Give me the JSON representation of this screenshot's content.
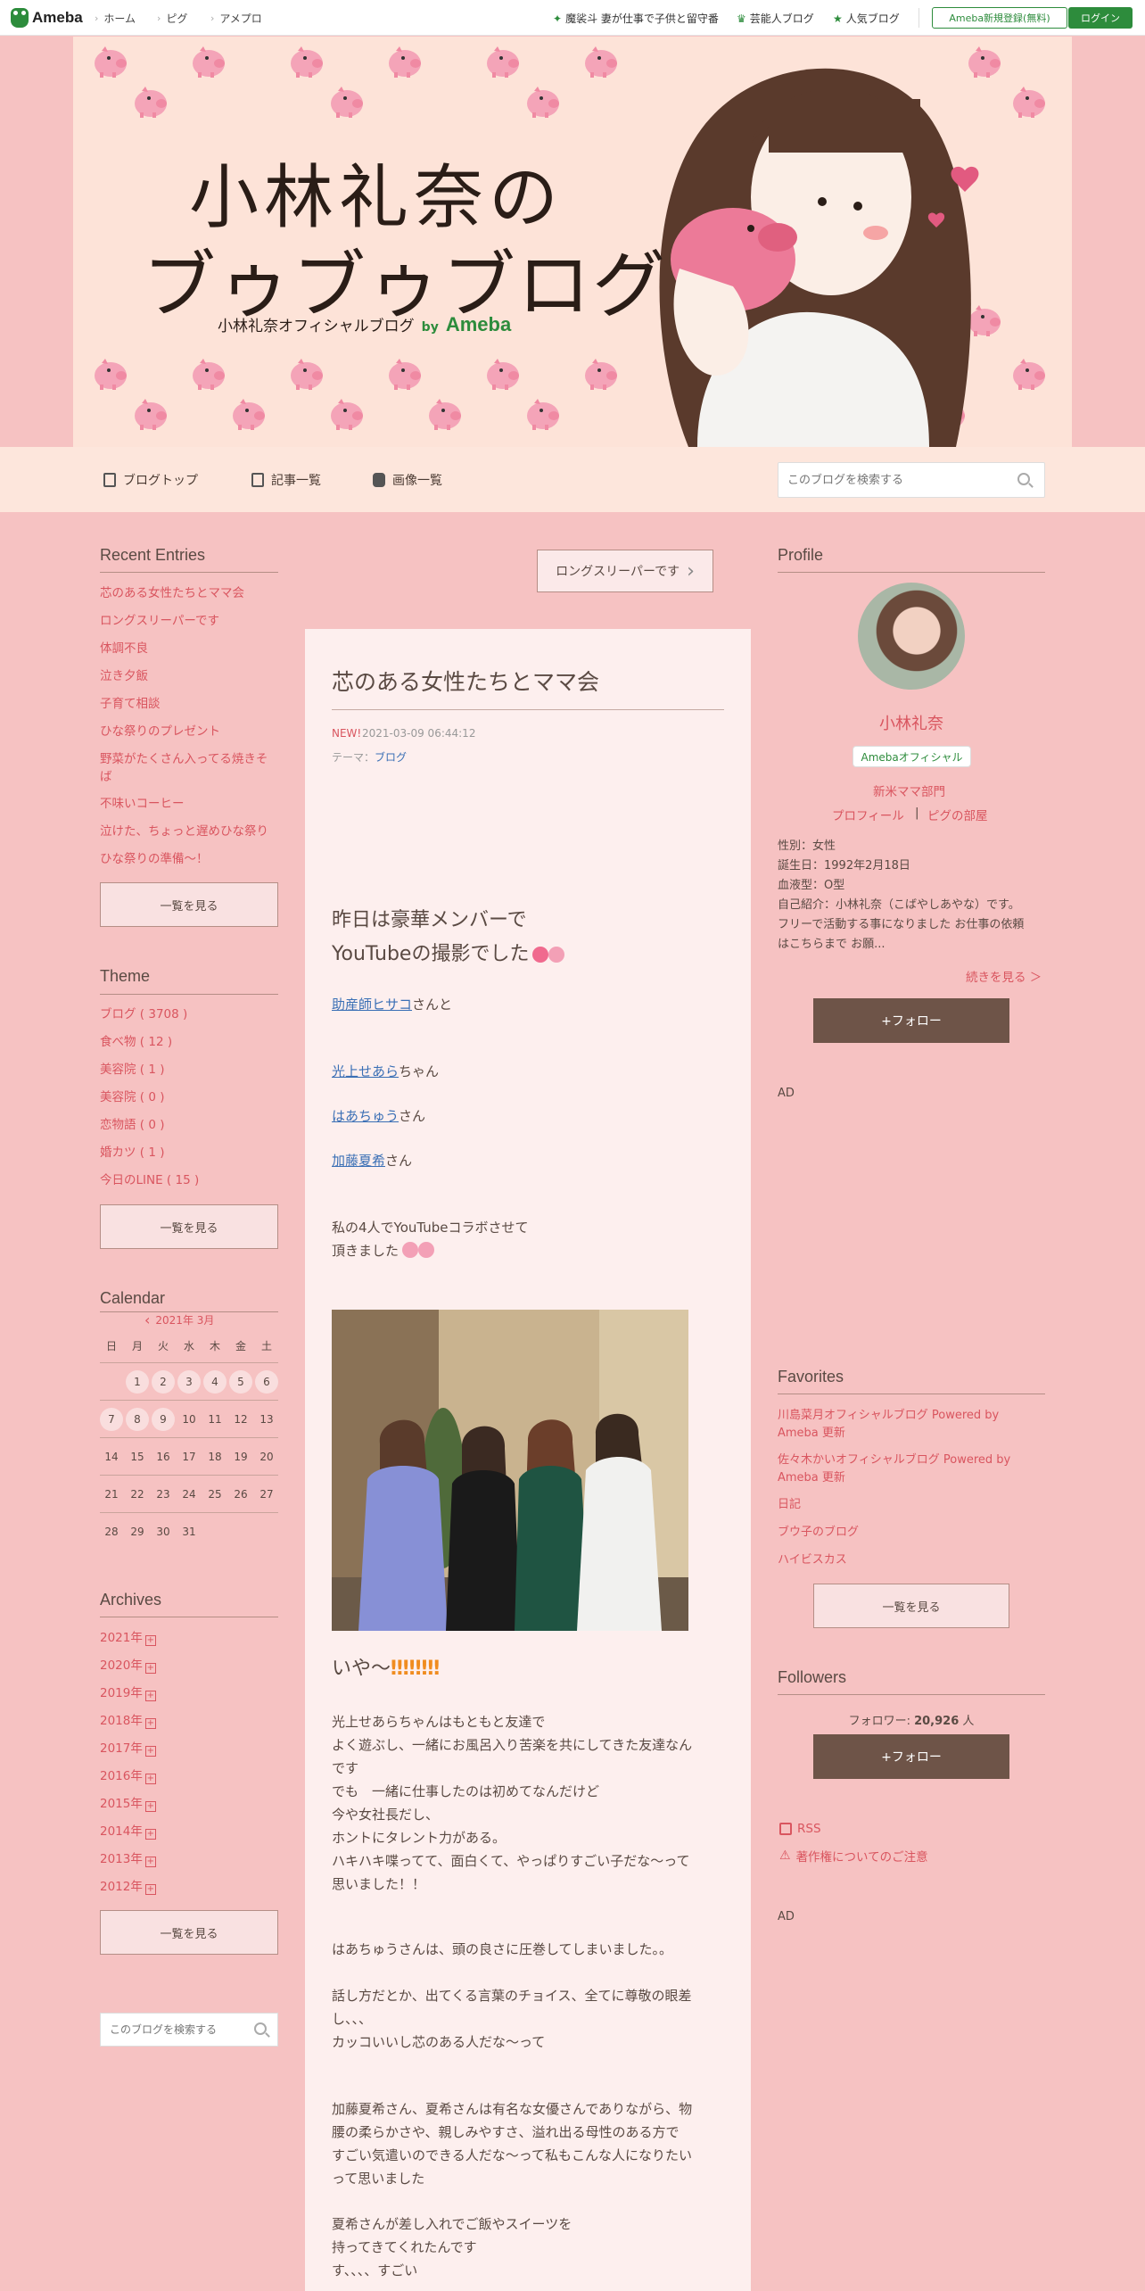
{
  "topbar": {
    "brand": "Ameba",
    "nav": [
      "ホーム",
      "ピグ",
      "アメプロ"
    ],
    "links": [
      "魔裟斗 妻が仕事で子供と留守番",
      "芸能人ブログ",
      "人気ブログ"
    ],
    "register_label": "Ameba新規登録(無料)",
    "login_label": "ログイン",
    "colors": {
      "accent": "#2d8c3c"
    }
  },
  "header": {
    "title_line1": "小林礼奈の",
    "title_line2": "ブゥブゥブログ",
    "subtitle": "小林礼奈オフィシャルブログ",
    "by": "by",
    "brand": "Ameba"
  },
  "blognav": {
    "items": [
      "ブログトップ",
      "記事一覧",
      "画像一覧"
    ],
    "search_placeholder": "このブログを検索する"
  },
  "left": {
    "recent_title": "Recent Entries",
    "recent": [
      "芯のある女性たちとママ会",
      "ロングスリーパーです",
      "体調不良",
      "泣き夕飯",
      "子育て相談",
      "ひな祭りのプレゼント",
      "野菜がたくさん入ってる焼きそ",
      "ば",
      "不味いコーヒー",
      "泣けた、ちょっと遅めひな祭り",
      "ひな祭りの準備〜！"
    ],
    "see_all": "一覧を見る",
    "theme_title": "Theme",
    "themes": [
      "ブログ ( 3708 )",
      "食べ物 ( 12 )",
      "美容院 ( 1 )",
      "美容院 ( 0 )",
      "恋物語 ( 0 )",
      "婚カツ ( 1 )",
      "今日のLINE ( 15 )"
    ],
    "calendar_title": "Calendar",
    "calendar_month": "2021年 3月",
    "calendar_weekdays": [
      "日",
      "月",
      "火",
      "水",
      "木",
      "金",
      "土"
    ],
    "calendar_rows": [
      [
        "",
        "1",
        "2",
        "3",
        "4",
        "5",
        "6"
      ],
      [
        "7",
        "8",
        "9",
        "10",
        "11",
        "12",
        "13"
      ],
      [
        "14",
        "15",
        "16",
        "17",
        "18",
        "19",
        "20"
      ],
      [
        "21",
        "22",
        "23",
        "24",
        "25",
        "26",
        "27"
      ],
      [
        "28",
        "29",
        "30",
        "31",
        "",
        "",
        ""
      ]
    ],
    "archives_title": "Archives",
    "archives": [
      "2021年",
      "2020年",
      "2019年",
      "2018年",
      "2017年",
      "2016年",
      "2015年",
      "2014年",
      "2013年",
      "2012年"
    ],
    "search_placeholder": "このブログを検索する"
  },
  "main": {
    "prev_label": "ロングスリーパーです",
    "title": "芯のある女性たちとママ会",
    "new_badge": "NEW!",
    "date": "2021-03-09 06:44:12",
    "theme_label": "テーマ：",
    "theme_link": "ブログ",
    "lead_line1": "昨日は豪華メンバーで",
    "lead_line2": "YouTubeの撮影でした",
    "person1_link": "助産師ヒサコ",
    "person1_suffix": "さんと",
    "person2_link": "光上せあら",
    "person2_suffix": "ちゃん",
    "person3_link": "はあちゅう",
    "person3_suffix": "さん",
    "person4_link": "加藤夏希",
    "person4_suffix": "さん",
    "collab_line1": "私の4人でYouTubeコラボさせて",
    "collab_line2": "頂きました",
    "iya": "いや〜",
    "para1": [
      "光上せあらちゃんはもともと友達で",
      "よく遊ぶし、一緒にお風呂入り苦楽を共にしてきた友達なん",
      "です",
      "でも　一緒に仕事したのは初めてなんだけど",
      "今や女社長だし、",
      "ホントにタレント力がある。",
      "ハキハキ喋ってて、面白くて、やっぱりすごい子だな〜って",
      "思いました！！"
    ],
    "para2": [
      "はあちゅうさんは、頭の良さに圧巻してしまいました。。",
      "",
      "話し方だとか、出てくる言葉のチョイス、全てに尊敬の眼差",
      "し、、、",
      "カッコいいし芯のある人だな〜って"
    ],
    "para3": [
      "加藤夏希さん、夏希さんは有名な女優さんでありながら、物",
      "腰の柔らかさや、親しみやすさ、溢れ出る母性のある方で",
      "すごい気遣いのできる人だな〜って私もこんな人になりたい",
      "って思いました"
    ],
    "para4": [
      "夏希さんが差し入れでご飯やスイーツを",
      "持ってきてくれたんです",
      "す、、、、すごい"
    ]
  },
  "right": {
    "profile_title": "Profile",
    "name": "小林礼奈",
    "official": "Amebaオフィシャル",
    "category": "新米ママ部門",
    "profile_link": "プロフィール",
    "pigg_link": "ピグの部屋",
    "sep": "|",
    "info": [
      "性別：女性",
      "誕生日：1992年2月18日",
      "血液型：O型",
      "自己紹介：小林礼奈（こばやしあやな）です。",
      "フリーで活動する事になりました お仕事の依頼",
      "はこちらまで お願..."
    ],
    "more": "続きを見る ＞",
    "follow": "+フォロー",
    "ad": "AD",
    "favorites_title": "Favorites",
    "favorites": [
      {
        "line1": "川島菜月オフィシャルブログ Powered by",
        "line2": "Ameba 更新"
      },
      {
        "line1": "佐々木かいオフィシャルブログ Powered by",
        "line2": "Ameba 更新"
      },
      {
        "line1": "日記",
        "line2": ""
      },
      {
        "line1": "ブウ子のブログ",
        "line2": ""
      },
      {
        "line1": "ハイビスカス",
        "line2": ""
      }
    ],
    "see_all": "一覧を見る",
    "followers_title": "Followers",
    "followers_label": "フォロワー:",
    "followers_count": "20,926",
    "followers_unit": "人",
    "rss": "RSS",
    "copyright": "著作権についてのご注意"
  }
}
